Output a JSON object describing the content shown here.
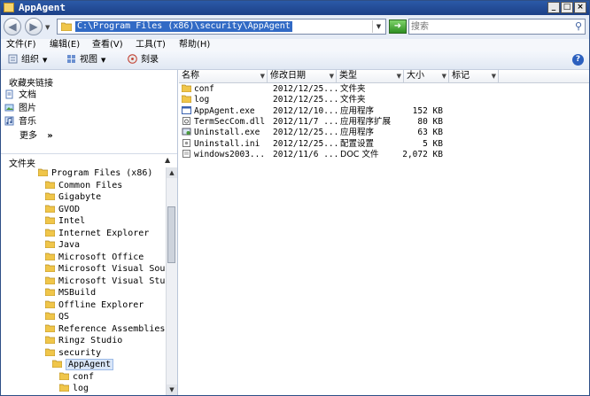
{
  "window": {
    "title": "AppAgent"
  },
  "caption_buttons": {
    "minimize": "_",
    "maximize": "□",
    "close": "×"
  },
  "address": {
    "path": "C:\\Program Files (x86)\\security\\AppAgent",
    "search_placeholder": "搜索"
  },
  "menu": [
    "文件(F)",
    "编辑(E)",
    "查看(V)",
    "工具(T)",
    "帮助(H)"
  ],
  "toolbar": {
    "organize": "组织",
    "views": "视图",
    "burn": "刻录",
    "help": "?"
  },
  "favorites": {
    "heading": "收藏夹链接",
    "items": [
      "文档",
      "图片",
      "音乐"
    ],
    "more": "更多",
    "more_arrow": "»"
  },
  "folders_heading": "文件夹",
  "tree": [
    {
      "label": "Program Files (x86)"
    },
    {
      "label": "Common Files"
    },
    {
      "label": "Gigabyte"
    },
    {
      "label": "GVOD"
    },
    {
      "label": "Intel"
    },
    {
      "label": "Internet Explorer"
    },
    {
      "label": "Java"
    },
    {
      "label": "Microsoft Office"
    },
    {
      "label": "Microsoft Visual SourceSafe"
    },
    {
      "label": "Microsoft Visual Studio"
    },
    {
      "label": "MSBuild"
    },
    {
      "label": "Offline Explorer"
    },
    {
      "label": "QS"
    },
    {
      "label": "Reference Assemblies"
    },
    {
      "label": "Ringz Studio"
    },
    {
      "label": "security"
    },
    {
      "label": "AppAgent",
      "selected": true
    },
    {
      "label": "conf"
    },
    {
      "label": "log"
    }
  ],
  "columns": [
    "名称",
    "修改日期",
    "类型",
    "大小",
    "标记"
  ],
  "files": [
    {
      "name": "conf",
      "date": "2012/12/25...",
      "type": "文件夹",
      "size": "",
      "icon": "folder-icon"
    },
    {
      "name": "log",
      "date": "2012/12/25...",
      "type": "文件夹",
      "size": "",
      "icon": "folder-icon"
    },
    {
      "name": "AppAgent.exe",
      "date": "2012/12/10...",
      "type": "应用程序",
      "size": "152 KB",
      "icon": "exe-icon"
    },
    {
      "name": "TermSecCom.dll",
      "date": "2012/11/7 ...",
      "type": "应用程序扩展",
      "size": "80 KB",
      "icon": "dll-icon"
    },
    {
      "name": "Uninstall.exe",
      "date": "2012/12/25...",
      "type": "应用程序",
      "size": "63 KB",
      "icon": "installer-icon"
    },
    {
      "name": "Uninstall.ini",
      "date": "2012/12/25...",
      "type": "配置设置",
      "size": "5 KB",
      "icon": "ini-icon"
    },
    {
      "name": "windows2003...",
      "date": "2012/11/6 ...",
      "type": "DOC 文件",
      "size": "2,072 KB",
      "icon": "doc-icon"
    }
  ],
  "colors": {
    "titlebar": "#1c3f86",
    "selection": "#316ac5",
    "folder": "#f0c64a"
  }
}
